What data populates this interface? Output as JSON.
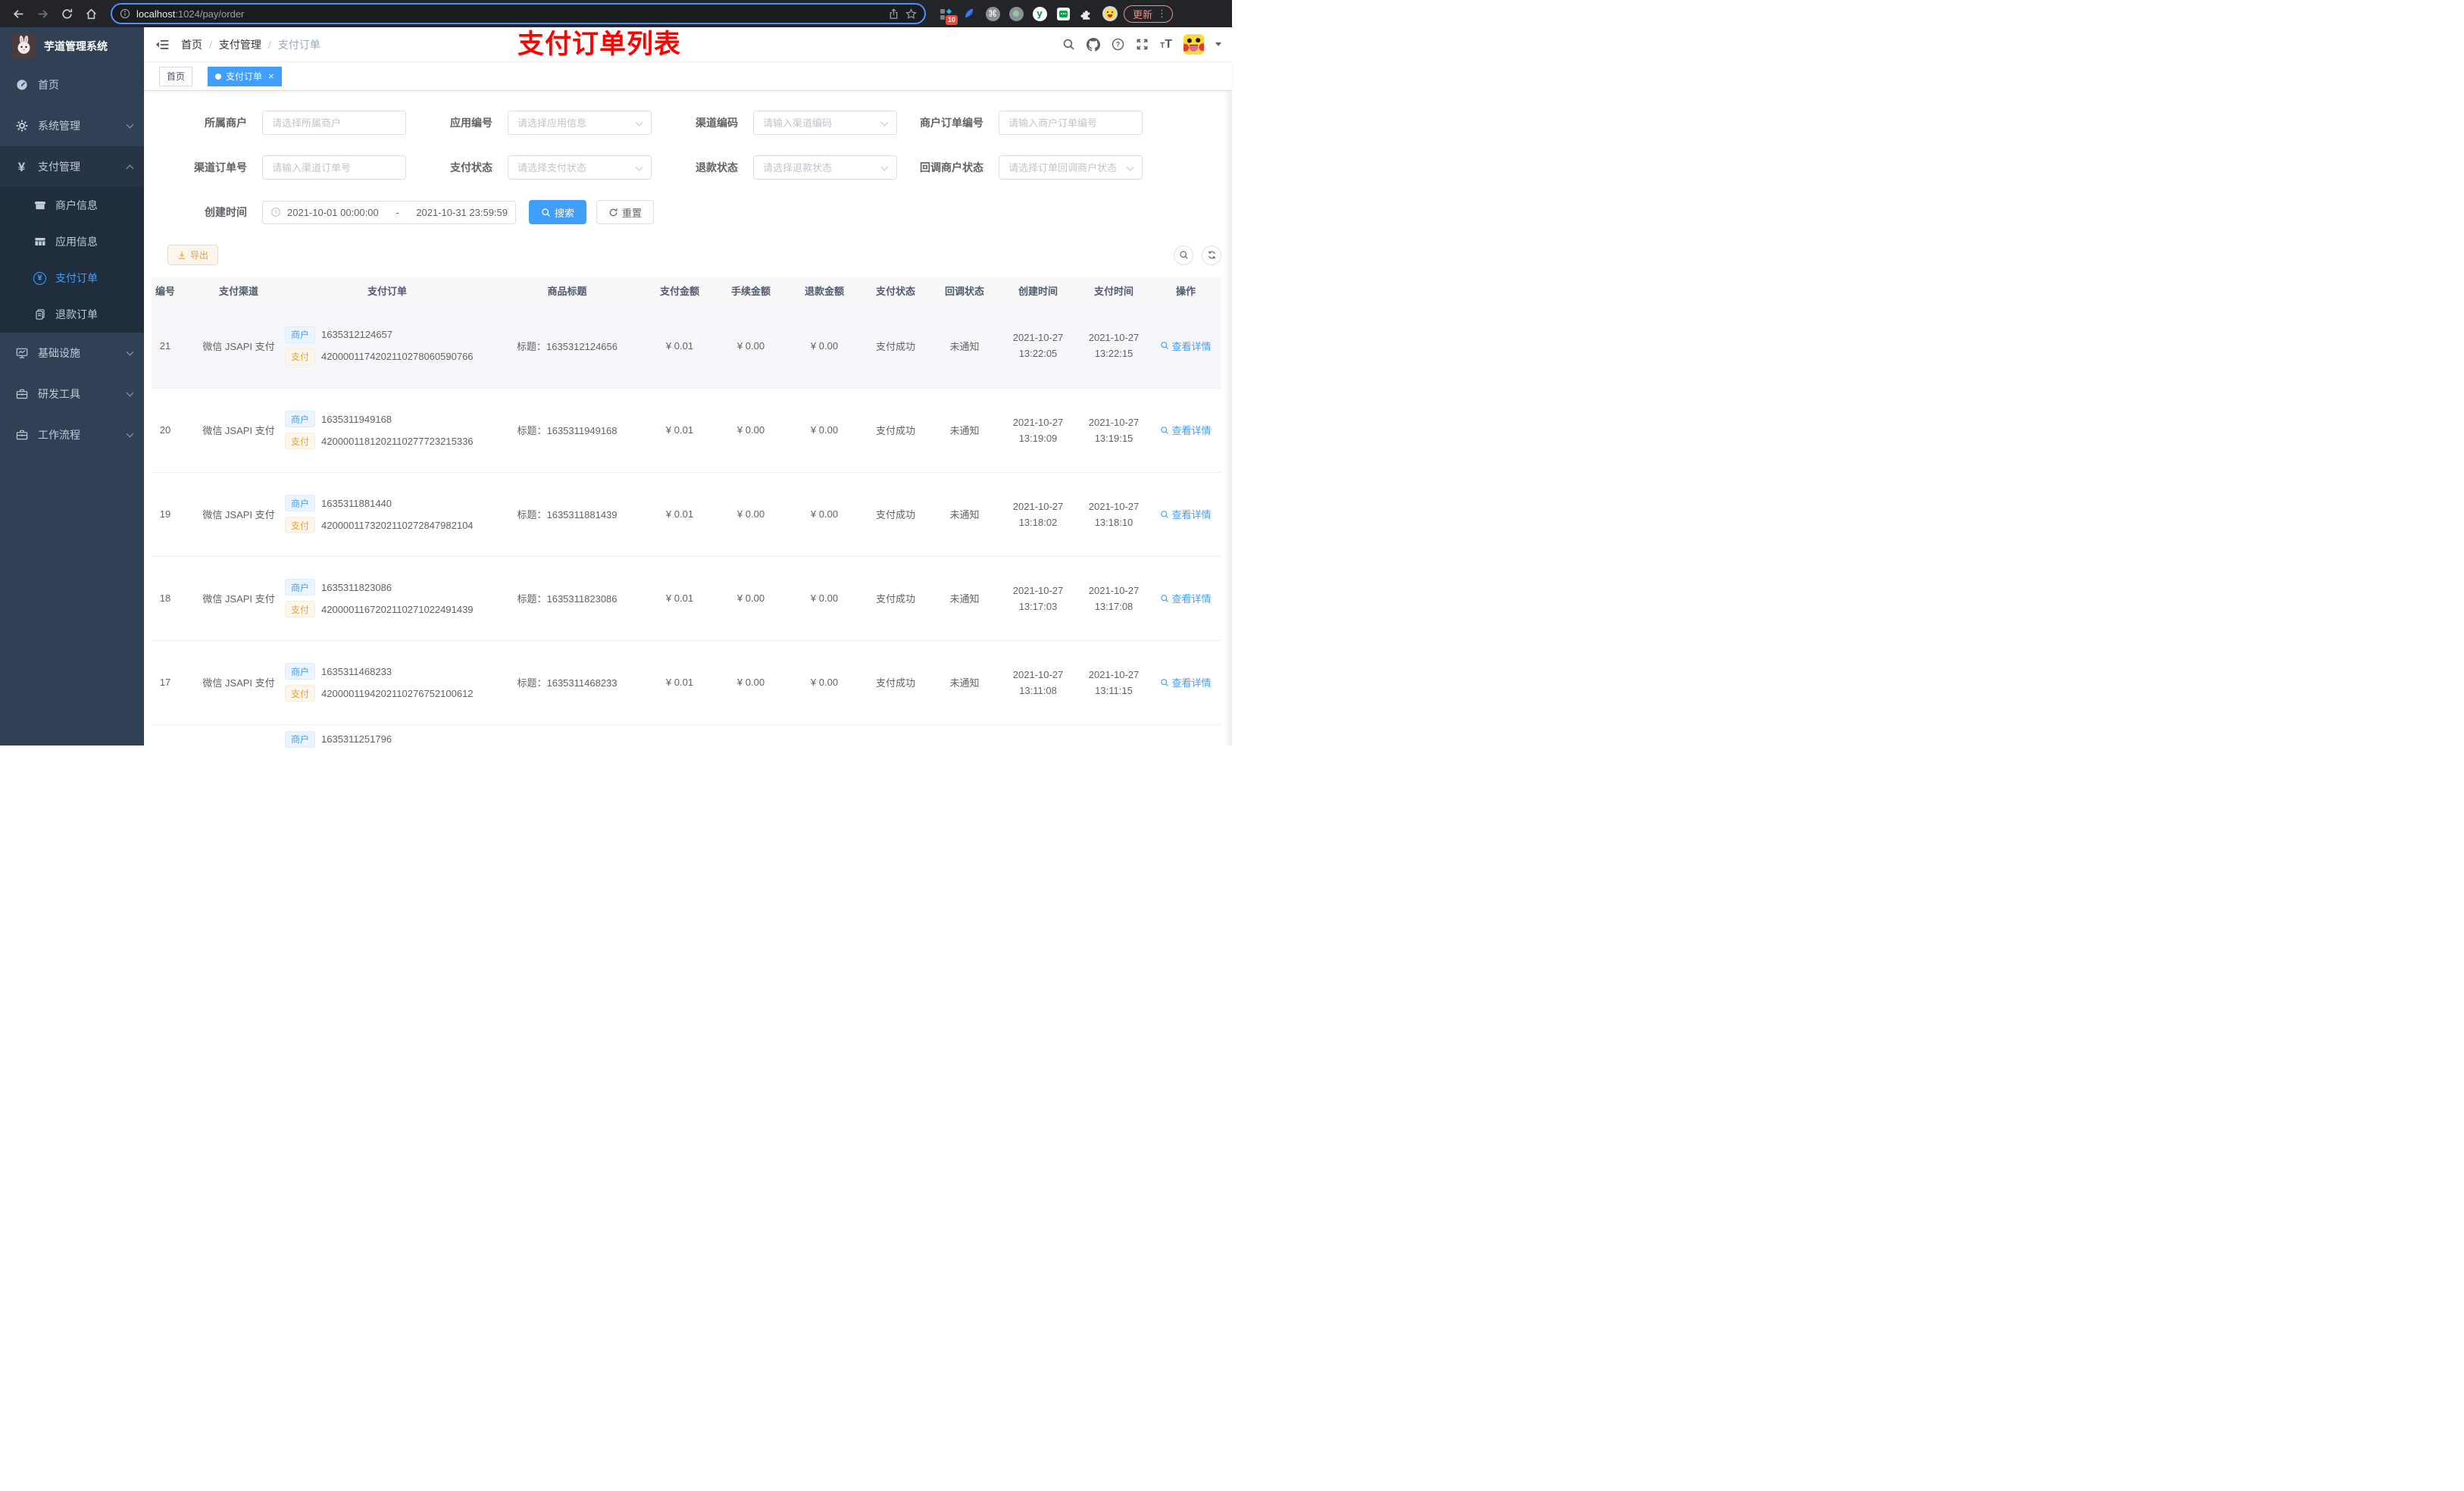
{
  "browser": {
    "url_host": "localhost",
    "url_path": ":1024/pay/order",
    "update_label": "更新",
    "extension_badge": "10",
    "ext_y_glyph": "y",
    "cmd_glyph": "⌘",
    "more_glyph": "⋮"
  },
  "sidebar": {
    "title": "芋道管理系统",
    "yen_glyph": "¥",
    "items": [
      {
        "label": "首页"
      },
      {
        "label": "系统管理"
      },
      {
        "label": "支付管理"
      },
      {
        "label": "商户信息"
      },
      {
        "label": "应用信息"
      },
      {
        "label": "支付订单"
      },
      {
        "label": "退款订单"
      },
      {
        "label": "基础设施"
      },
      {
        "label": "研发工具"
      },
      {
        "label": "工作流程"
      }
    ]
  },
  "header": {
    "breadcrumb": {
      "home": "首页",
      "section": "支付管理",
      "current": "支付订单",
      "separator": "/"
    },
    "heading": "支付订单列表",
    "question_glyph": "?",
    "font_glyph_small": "T",
    "font_glyph_big": "T"
  },
  "tabs": {
    "home": "首页",
    "current": "支付订单",
    "close_glyph": "×"
  },
  "filters": {
    "row1": [
      {
        "label": "所属商户",
        "placeholder": "请选择所属商户"
      },
      {
        "label": "应用编号",
        "placeholder": "请选择应用信息"
      },
      {
        "label": "渠道编码",
        "placeholder": "请输入渠道编码"
      },
      {
        "label": "商户订单编号",
        "placeholder": "请输入商户订单编号"
      }
    ],
    "row2": [
      {
        "label": "渠道订单号",
        "placeholder": "请输入渠道订单号"
      },
      {
        "label": "支付状态",
        "placeholder": "请选择支付状态"
      },
      {
        "label": "退款状态",
        "placeholder": "请选择退款状态"
      },
      {
        "label": "回调商户状态",
        "placeholder": "请选择订单回调商户状态"
      }
    ],
    "date": {
      "label": "创建时间",
      "start": "2021-10-01 00:00:00",
      "separator": "-",
      "end": "2021-10-31 23:59:59"
    },
    "search_label": "搜索",
    "reset_label": "重置"
  },
  "toolbar": {
    "export_label": "导出"
  },
  "table": {
    "columns": [
      "编号",
      "支付渠道",
      "支付订单",
      "商品标题",
      "支付金额",
      "手续金额",
      "退款金额",
      "支付状态",
      "回调状态",
      "创建时间",
      "支付时间",
      "操作"
    ],
    "merchant_tag": "商户",
    "pay_tag": "支付",
    "action_label": "查看详情",
    "rows": [
      {
        "id": "21",
        "channel": "微信 JSAPI 支付",
        "merchant_no": "1635312124657",
        "pay_no": "4200001174202110278060590766",
        "title": "标题：1635312124656",
        "amount": "¥ 0.01",
        "fee": "¥ 0.00",
        "refund": "¥ 0.00",
        "status": "支付成功",
        "notify": "未通知",
        "create_date": "2021-10-27",
        "create_time": "13:22:05",
        "pay_date": "2021-10-27",
        "pay_time": "13:22:15"
      },
      {
        "id": "20",
        "channel": "微信 JSAPI 支付",
        "merchant_no": "1635311949168",
        "pay_no": "4200001181202110277723215336",
        "title": "标题：1635311949168",
        "amount": "¥ 0.01",
        "fee": "¥ 0.00",
        "refund": "¥ 0.00",
        "status": "支付成功",
        "notify": "未通知",
        "create_date": "2021-10-27",
        "create_time": "13:19:09",
        "pay_date": "2021-10-27",
        "pay_time": "13:19:15"
      },
      {
        "id": "19",
        "channel": "微信 JSAPI 支付",
        "merchant_no": "1635311881440",
        "pay_no": "4200001173202110272847982104",
        "title": "标题：1635311881439",
        "amount": "¥ 0.01",
        "fee": "¥ 0.00",
        "refund": "¥ 0.00",
        "status": "支付成功",
        "notify": "未通知",
        "create_date": "2021-10-27",
        "create_time": "13:18:02",
        "pay_date": "2021-10-27",
        "pay_time": "13:18:10"
      },
      {
        "id": "18",
        "channel": "微信 JSAPI 支付",
        "merchant_no": "1635311823086",
        "pay_no": "4200001167202110271022491439",
        "title": "标题：1635311823086",
        "amount": "¥ 0.01",
        "fee": "¥ 0.00",
        "refund": "¥ 0.00",
        "status": "支付成功",
        "notify": "未通知",
        "create_date": "2021-10-27",
        "create_time": "13:17:03",
        "pay_date": "2021-10-27",
        "pay_time": "13:17:08"
      },
      {
        "id": "17",
        "channel": "微信 JSAPI 支付",
        "merchant_no": "1635311468233",
        "pay_no": "4200001194202110276752100612",
        "title": "标题：1635311468233",
        "amount": "¥ 0.01",
        "fee": "¥ 0.00",
        "refund": "¥ 0.00",
        "status": "支付成功",
        "notify": "未通知",
        "create_date": "2021-10-27",
        "create_time": "13:11:08",
        "pay_date": "2021-10-27",
        "pay_time": "13:11:15"
      }
    ],
    "partial_row": {
      "merchant_no": "1635311251796"
    }
  }
}
